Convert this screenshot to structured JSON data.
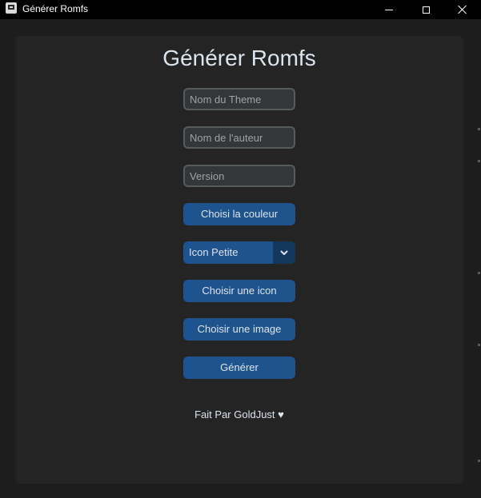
{
  "window": {
    "title": "Générer Romfs"
  },
  "main": {
    "heading": "Générer Romfs",
    "fields": {
      "theme_name": {
        "placeholder": "Nom du Theme",
        "value": ""
      },
      "author_name": {
        "placeholder": "Nom de l'auteur",
        "value": ""
      },
      "version": {
        "placeholder": "Version",
        "value": ""
      }
    },
    "buttons": {
      "choose_color": "Choisi la couleur",
      "choose_icon": "Choisir une icon",
      "choose_image": "Choisir une image",
      "generate": "Générer"
    },
    "dropdown": {
      "selected": "Icon Petite"
    },
    "credit": "Fait Par GoldJust ♥"
  },
  "colors": {
    "accent": "#1f538d",
    "accent_dark": "#14375e",
    "background": "#1d1d1d",
    "panel": "#242424",
    "text": "#dce4ee"
  },
  "icons": {
    "app": "app-window-icon",
    "minimize": "minimize-icon",
    "maximize": "maximize-icon",
    "close": "close-icon",
    "dropdown": "chevron-down-icon"
  }
}
